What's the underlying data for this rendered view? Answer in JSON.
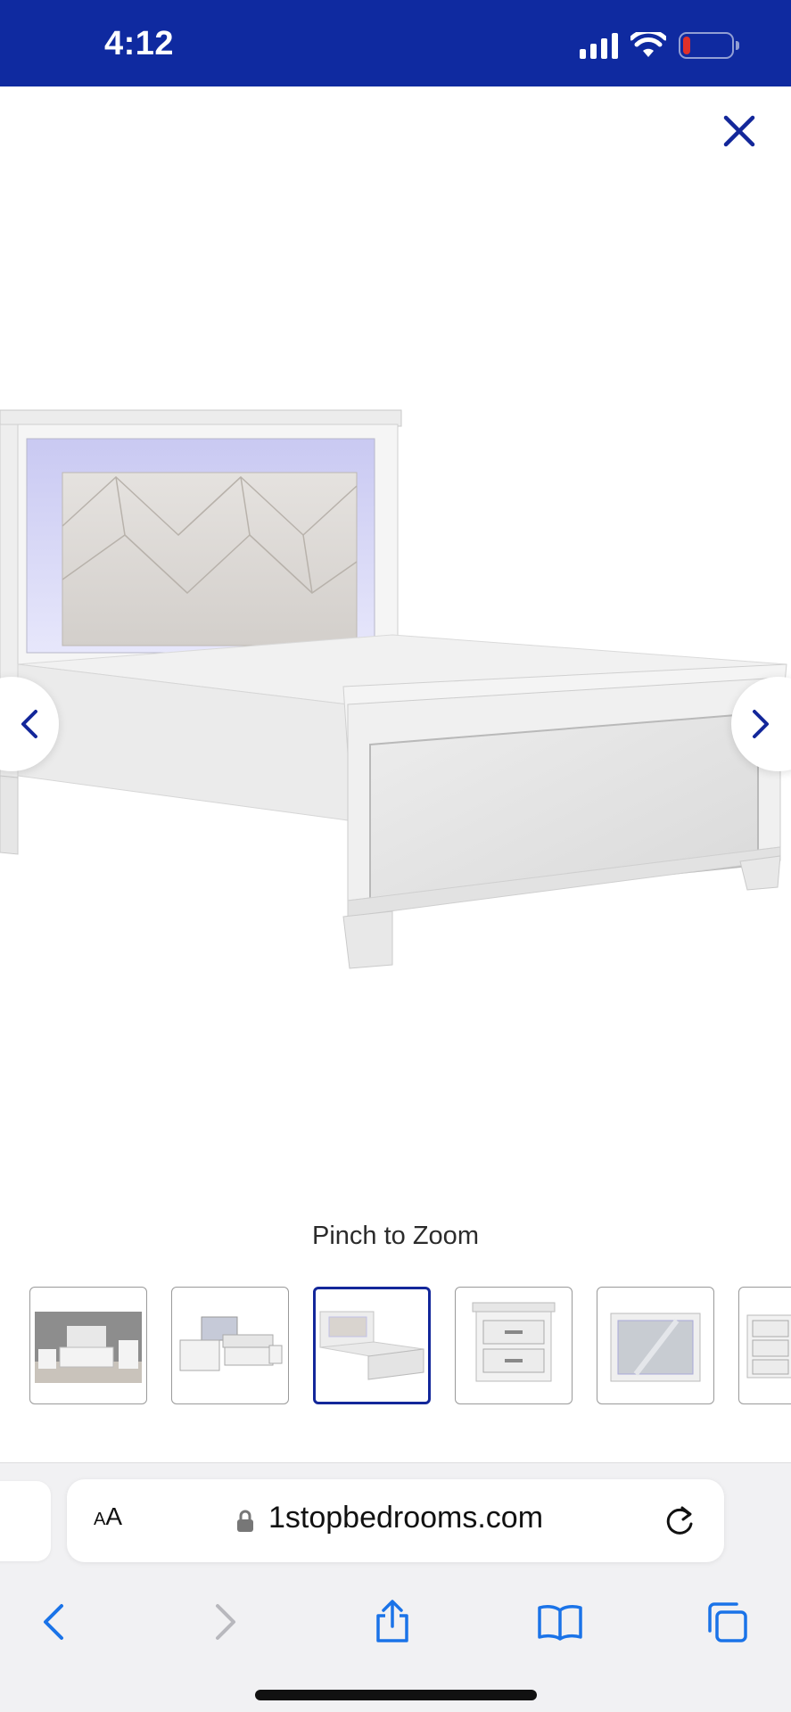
{
  "status_bar": {
    "time": "4:12",
    "icons": [
      "signal-icon",
      "wifi-icon",
      "battery-icon"
    ],
    "battery_level_percent": 12,
    "battery_color": "#e0302a",
    "background_color": "#0f2aa0"
  },
  "viewer": {
    "close_icon": "close-icon",
    "prev_icon": "chevron-left-icon",
    "next_icon": "chevron-right-icon",
    "pinch_text": "Pinch to Zoom",
    "accent_color": "#13279a",
    "thumbnails": [
      {
        "name": "bedroom-set-room"
      },
      {
        "name": "bedroom-set-lit"
      },
      {
        "name": "bed-frame",
        "selected": true
      },
      {
        "name": "nightstand"
      },
      {
        "name": "mirror"
      },
      {
        "name": "dresser"
      }
    ]
  },
  "browser": {
    "text_size_label_small": "A",
    "text_size_label_large": "A",
    "url": "1stopbedrooms.com",
    "icons": [
      "lock-icon",
      "reload-icon",
      "back-icon",
      "forward-icon",
      "share-icon",
      "bookmarks-icon",
      "tabs-icon"
    ],
    "accent_color": "#1a73e8"
  }
}
